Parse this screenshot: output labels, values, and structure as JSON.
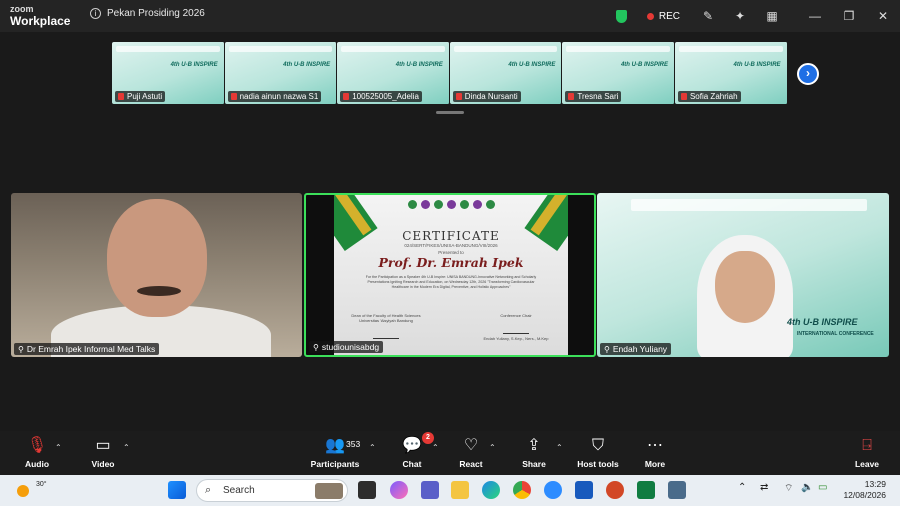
{
  "titlebar": {
    "brand_top": "zoom",
    "brand_bottom": "Workplace",
    "meeting_title": "Pekan Prosiding 2026",
    "rec_label": "REC",
    "icons": [
      "shield-icon",
      "annotate-icon",
      "ai-companion-icon",
      "apps-icon",
      "minimize-icon",
      "restore-icon",
      "close-icon"
    ]
  },
  "strip": {
    "participants": [
      {
        "name": "Puji Astuti"
      },
      {
        "name": "nadia ainun nazwa S1"
      },
      {
        "name": "100525005_Adelia"
      },
      {
        "name": "Dinda Nursanti"
      },
      {
        "name": "Tresna Sari"
      },
      {
        "name": "Sofia Zahriah"
      }
    ],
    "thumb_inspire": "4th U-B INSPIRE"
  },
  "gallery": {
    "tile_a_name": "Dr Emrah Ipek Informal Med Talks",
    "tile_b_name": "studiounisabdg",
    "tile_c_name": "Endah Yuliany"
  },
  "certificate": {
    "title": "CERTIFICATE",
    "number": "024/SERT/FIKES/UNISA-BANDUNG/VIII/2026",
    "presented_to": "Presented to",
    "recipient": "Prof. Dr. Emrah Ipek",
    "body": "For the Participation as a Speaker 4th U-B Inspire: UNISA BANDUNG-Innovative Networking and Scholarly Presentations Igniting Research and Education, on Wednesday 12th, 2026 \"Transforming Cardiovascular Healthcare in the Modern Era Digital, Preventive, and Holistic Approaches\"",
    "sig_left_title": "Dean of the Faculty of Health Sciences Universitas 'Aisyiyah Bandung",
    "sig_right_title": "Conference Chair",
    "sig_right_name": "Endah Yuliany, S.Kep., Ners., M.Kep"
  },
  "endah_tile": {
    "inspire": "4th U-B INSPIRE",
    "conference": "INTERNATIONAL CONFERENCE"
  },
  "controls": {
    "audio": "Audio",
    "video": "Video",
    "participants": "Participants",
    "participants_count": "353",
    "chat": "Chat",
    "chat_badge": "2",
    "react": "React",
    "share": "Share",
    "host_tools": "Host tools",
    "more": "More",
    "leave": "Leave"
  },
  "taskbar": {
    "temperature": "30°",
    "search_placeholder": "Search",
    "time": "13:29",
    "date": "12/08/2026"
  }
}
